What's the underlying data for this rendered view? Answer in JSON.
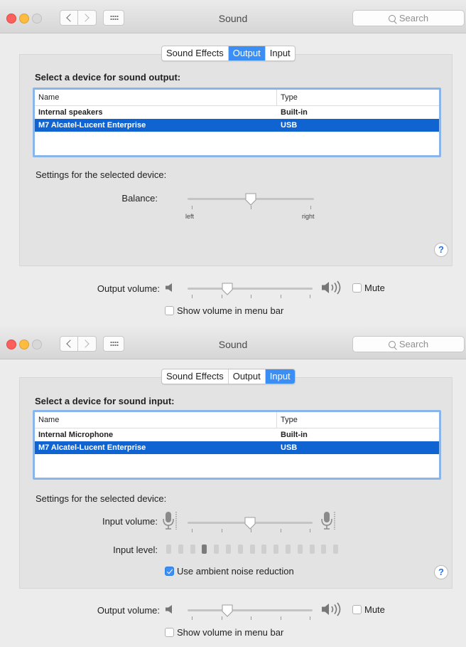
{
  "output_window": {
    "title": "Sound",
    "search_placeholder": "Search",
    "tabs": [
      "Sound Effects",
      "Output",
      "Input"
    ],
    "selected_tab": "Output",
    "heading": "Select a device for sound output:",
    "columns": [
      "Name",
      "Type"
    ],
    "rows": [
      {
        "name": "Internal speakers",
        "type": "Built-in"
      },
      {
        "name": "M7 Alcatel-Lucent Enterprise",
        "type": "USB"
      }
    ],
    "selected_row": 1,
    "settings_label": "Settings for the selected device:",
    "balance_label": "Balance:",
    "balance_left": "left",
    "balance_right": "right",
    "balance_value": 0.5,
    "output_volume_label": "Output volume:",
    "output_volume_value": 0.32,
    "mute_label": "Mute",
    "mute_checked": false,
    "show_volume_label": "Show volume in menu bar",
    "show_volume_checked": false,
    "help_label": "?"
  },
  "input_window": {
    "title": "Sound",
    "search_placeholder": "Search",
    "tabs": [
      "Sound Effects",
      "Output",
      "Input"
    ],
    "selected_tab": "Input",
    "heading": "Select a device for sound input:",
    "columns": [
      "Name",
      "Type"
    ],
    "rows": [
      {
        "name": "Internal Microphone",
        "type": "Built-in"
      },
      {
        "name": "M7 Alcatel-Lucent Enterprise",
        "type": "USB"
      }
    ],
    "selected_row": 1,
    "settings_label": "Settings for the selected device:",
    "input_volume_label": "Input volume:",
    "input_volume_value": 0.5,
    "input_level_label": "Input level:",
    "input_level_segments": 15,
    "input_level_active": 3,
    "noise_reduction_label": "Use ambient noise reduction",
    "noise_reduction_checked": true,
    "output_volume_label": "Output volume:",
    "output_volume_value": 0.32,
    "mute_label": "Mute",
    "mute_checked": false,
    "show_volume_label": "Show volume in menu bar",
    "show_volume_checked": false,
    "help_label": "?"
  },
  "colors": {
    "accent": "#3b8ef3",
    "row_selected": "#0f64d2",
    "close": "#fc605c",
    "minimize": "#fdbc40"
  },
  "icons": [
    "chevron-left-icon",
    "chevron-right-icon",
    "grid-icon",
    "search-icon",
    "speaker-low-icon",
    "speaker-high-icon",
    "microphone-icon",
    "help-icon",
    "checkmark-icon"
  ]
}
